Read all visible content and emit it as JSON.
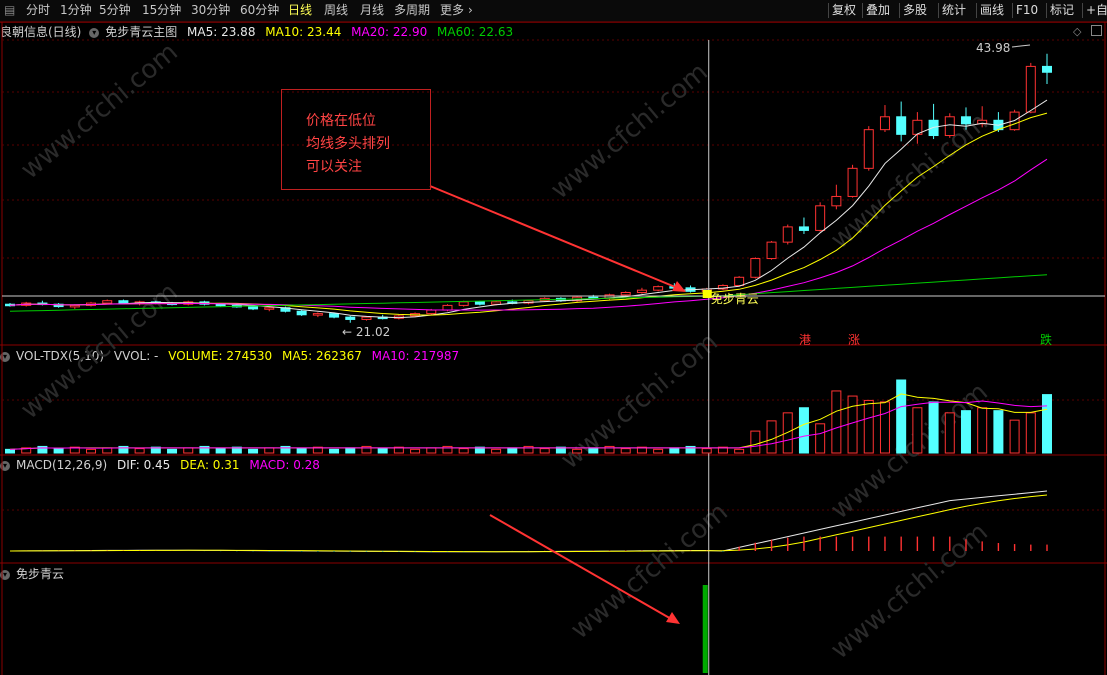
{
  "toolbar": {
    "periods": [
      "分时",
      "1分钟",
      "5分钟",
      "15分钟",
      "30分钟",
      "60分钟",
      "日线",
      "周线",
      "月线",
      "多周期",
      "更多"
    ],
    "active_period": "日线",
    "more_icon": "chevron-right-icon",
    "right_buttons": [
      "复权",
      "叠加",
      "多股",
      "统计",
      "画线",
      "F10",
      "标记",
      "+自"
    ]
  },
  "main_header": {
    "stock": "良朝信息(日线)",
    "indicator": "免步青云主图",
    "ma5": "MA5: 23.88",
    "ma10": "MA10: 23.44",
    "ma20": "MA20: 22.90",
    "ma60": "MA60: 22.63"
  },
  "vol_header": {
    "name": "VOL-TDX(5,10)",
    "vvol": "VVOL: -",
    "volume": "VOLUME: 274530",
    "ma5": "MA5: 262367",
    "ma10": "MA10: 217987"
  },
  "macd_header": {
    "name": "MACD(12,26,9)",
    "dif": "DIF: 0.45",
    "dea": "DEA: 0.31",
    "macd": "MACD: 0.28"
  },
  "signal_header": {
    "name": "免步青云"
  },
  "annotation": [
    "价格在低位",
    "均线多头排列",
    "可以关注"
  ],
  "marks": {
    "high_label": "43.98",
    "low_label": "21.02",
    "signal_text": "免步青云",
    "tags": [
      "港",
      "涨",
      "跌"
    ]
  },
  "watermark": "www.cfchi.com",
  "colors": {
    "up": "#ff3232",
    "down": "#54ffff",
    "ma5": "#e8e8e8",
    "ma10": "#ffff00",
    "ma20": "#ff00ff",
    "ma60": "#00cc00",
    "signal": "#00aa00"
  },
  "chart_data": [
    {
      "type": "candlestick",
      "title": "免步青云主图",
      "marked_high": 43.98,
      "marked_low": 21.02,
      "series": [
        {
          "name": "MA5",
          "last": 23.88
        },
        {
          "name": "MA10",
          "last": 23.44
        },
        {
          "name": "MA20",
          "last": 22.9
        },
        {
          "name": "MA60",
          "last": 22.63
        }
      ],
      "candles": [
        [
          22.6,
          22.7,
          22.4,
          22.5
        ],
        [
          22.5,
          22.8,
          22.4,
          22.7
        ],
        [
          22.7,
          22.9,
          22.5,
          22.6
        ],
        [
          22.6,
          22.7,
          22.3,
          22.4
        ],
        [
          22.4,
          22.6,
          22.2,
          22.5
        ],
        [
          22.5,
          22.8,
          22.4,
          22.7
        ],
        [
          22.7,
          23.0,
          22.6,
          22.9
        ],
        [
          22.9,
          23.0,
          22.6,
          22.7
        ],
        [
          22.7,
          22.9,
          22.5,
          22.8
        ],
        [
          22.8,
          22.9,
          22.6,
          22.7
        ],
        [
          22.7,
          22.8,
          22.5,
          22.6
        ],
        [
          22.6,
          22.9,
          22.5,
          22.8
        ],
        [
          22.8,
          22.9,
          22.5,
          22.6
        ],
        [
          22.6,
          22.7,
          22.4,
          22.5
        ],
        [
          22.5,
          22.7,
          22.3,
          22.4
        ],
        [
          22.4,
          22.5,
          22.1,
          22.2
        ],
        [
          22.2,
          22.4,
          22.0,
          22.3
        ],
        [
          22.3,
          22.4,
          21.9,
          22.0
        ],
        [
          22.0,
          22.1,
          21.6,
          21.7
        ],
        [
          21.7,
          21.9,
          21.5,
          21.8
        ],
        [
          21.8,
          21.9,
          21.4,
          21.5
        ],
        [
          21.5,
          21.6,
          21.02,
          21.3
        ],
        [
          21.3,
          21.6,
          21.2,
          21.5
        ],
        [
          21.5,
          21.7,
          21.3,
          21.4
        ],
        [
          21.4,
          21.7,
          21.3,
          21.6
        ],
        [
          21.6,
          21.9,
          21.5,
          21.8
        ],
        [
          21.8,
          22.2,
          21.7,
          22.1
        ],
        [
          22.1,
          22.6,
          22.0,
          22.5
        ],
        [
          22.5,
          22.9,
          22.4,
          22.8
        ],
        [
          22.8,
          22.9,
          22.5,
          22.6
        ],
        [
          22.6,
          22.9,
          22.5,
          22.8
        ],
        [
          22.8,
          23.0,
          22.6,
          22.7
        ],
        [
          22.7,
          23.0,
          22.6,
          22.9
        ],
        [
          22.9,
          23.2,
          22.8,
          23.1
        ],
        [
          23.1,
          23.2,
          22.8,
          22.9
        ],
        [
          22.9,
          23.3,
          22.8,
          23.2
        ],
        [
          23.2,
          23.4,
          23.0,
          23.1
        ],
        [
          23.1,
          23.5,
          23.0,
          23.4
        ],
        [
          23.4,
          23.7,
          23.3,
          23.6
        ],
        [
          23.6,
          24.0,
          23.5,
          23.8
        ],
        [
          23.8,
          24.2,
          23.7,
          24.1
        ],
        [
          24.1,
          24.4,
          23.9,
          24.0
        ],
        [
          24.0,
          24.2,
          23.6,
          23.7
        ],
        [
          23.7,
          24.0,
          23.6,
          23.9
        ],
        [
          23.9,
          24.3,
          23.8,
          24.2
        ],
        [
          24.2,
          25.0,
          24.1,
          24.9
        ],
        [
          24.9,
          26.6,
          24.8,
          26.5
        ],
        [
          26.5,
          28.0,
          26.4,
          27.9
        ],
        [
          27.9,
          29.4,
          27.7,
          29.2
        ],
        [
          29.2,
          30.0,
          28.6,
          28.9
        ],
        [
          28.9,
          31.3,
          28.8,
          31.0
        ],
        [
          31.0,
          32.8,
          30.7,
          31.8
        ],
        [
          31.8,
          34.5,
          31.7,
          34.2
        ],
        [
          34.2,
          37.8,
          34.0,
          37.5
        ],
        [
          37.5,
          39.6,
          37.3,
          38.6
        ],
        [
          38.6,
          39.9,
          36.5,
          37.1
        ],
        [
          37.1,
          39.0,
          36.3,
          38.3
        ],
        [
          38.3,
          39.7,
          36.7,
          37.0
        ],
        [
          37.0,
          38.9,
          36.8,
          38.6
        ],
        [
          38.6,
          39.4,
          37.5,
          38.0
        ],
        [
          38.0,
          39.5,
          37.7,
          38.3
        ],
        [
          38.3,
          39.0,
          37.3,
          37.5
        ],
        [
          37.5,
          39.2,
          37.4,
          39.0
        ],
        [
          39.0,
          43.2,
          38.9,
          42.9
        ],
        [
          42.9,
          43.98,
          41.4,
          42.4
        ]
      ]
    },
    {
      "type": "bar",
      "title": "VOL-TDX(5,10)",
      "series": [
        {
          "name": "VOLUME",
          "last": 274530
        },
        {
          "name": "MA5",
          "last": 262367
        },
        {
          "name": "MA10",
          "last": 217987
        }
      ]
    },
    {
      "type": "bar",
      "title": "MACD(12,26,9)",
      "series": [
        {
          "name": "DIF",
          "last": 0.45
        },
        {
          "name": "DEA",
          "last": 0.31
        },
        {
          "name": "MACD",
          "last": 0.28
        }
      ]
    },
    {
      "type": "bar",
      "title": "免步青云",
      "signal_index": 43
    }
  ]
}
